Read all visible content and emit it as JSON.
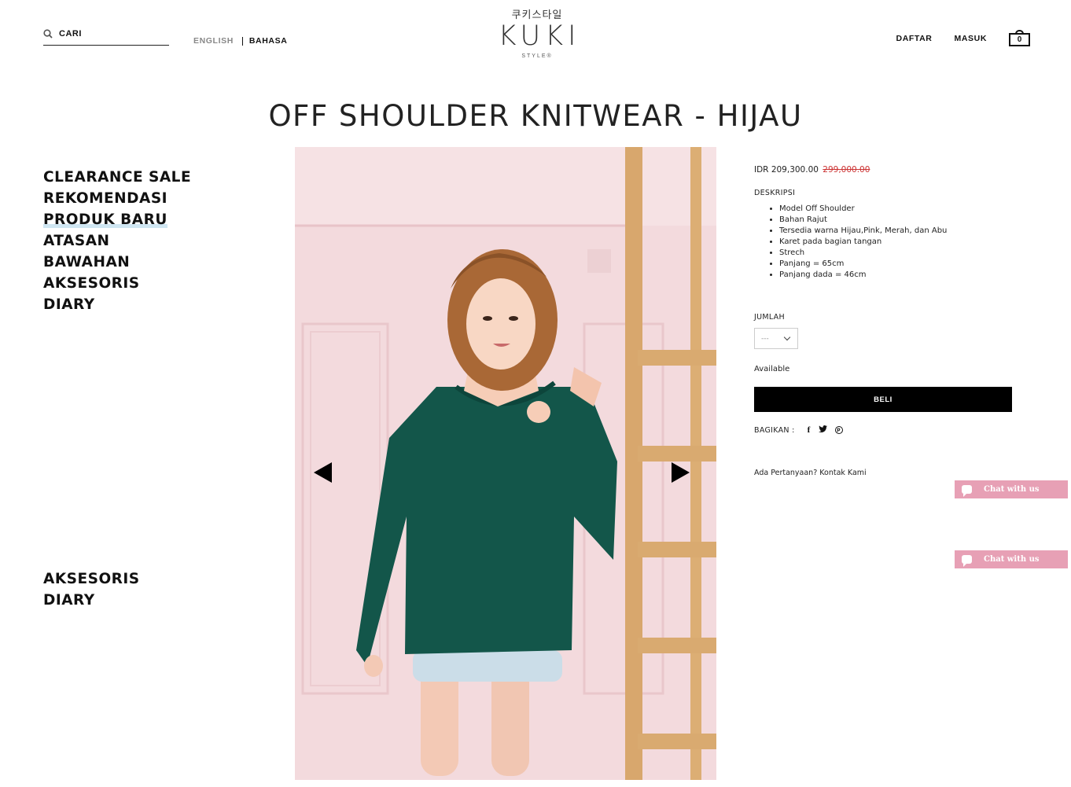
{
  "header": {
    "search": {
      "placeholder": "CARI"
    },
    "languages": [
      "ENGLISH",
      "BAHASA"
    ],
    "logo": {
      "korean": "쿠키스타일",
      "main": "KUKI",
      "sub": "STYLE®"
    },
    "nav": {
      "register": "DAFTAR",
      "login": "MASUK"
    },
    "cart_count": "0"
  },
  "product": {
    "title": "OFF SHOULDER KNITWEAR - HIJAU",
    "price_current": "IDR 209,300.00",
    "price_original": "299,000.00",
    "description_label": "DESKRIPSI",
    "description_items": [
      "Model Off Shoulder",
      "Bahan Rajut",
      "Tersedia warna Hijau,Pink, Merah, dan Abu",
      "Karet pada bagian tangan",
      "Strech",
      "Panjang = 65cm",
      "Panjang dada = 46cm"
    ],
    "quantity_label": "JUMLAH",
    "quantity_value": "---",
    "availability": "Available",
    "buy_label": "BELI",
    "share_label": "BAGIKAN :",
    "contact": "Ada Pertanyaan? Kontak Kami"
  },
  "menu_top": [
    "CLEARANCE SALE",
    "REKOMENDASI",
    "PRODUK BARU",
    "ATASAN",
    "BAWAHAN",
    "AKSESORIS",
    "DIARY"
  ],
  "menu_bottom": [
    "AKSESORIS",
    "DIARY"
  ],
  "chat_widgets": [
    "Chat with us",
    "Chat with us"
  ],
  "colors": {
    "accent_chat": "#e7a0b5",
    "buy_button": "#000000",
    "sweater": "#13564a",
    "backdrop": "#f2d8dc",
    "price_strike": "#cc3333"
  }
}
